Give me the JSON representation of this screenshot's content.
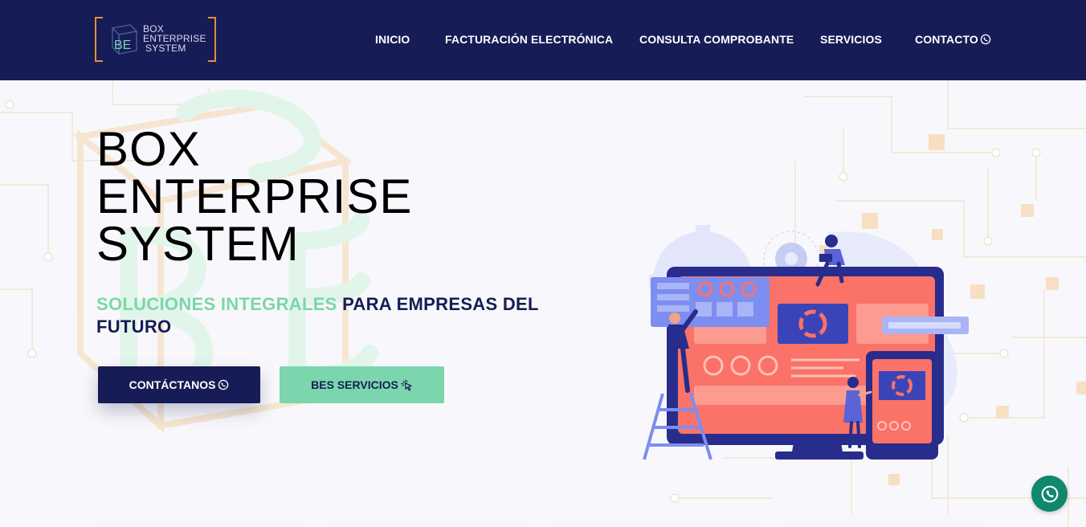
{
  "brand": {
    "logo_lines": [
      "BOX",
      "ENTERPRISE",
      "SYSTEM"
    ],
    "logo_letters": "BE",
    "colors": {
      "navy": "#161c55",
      "green": "#7bd6ad",
      "orange": "#e0913a",
      "coral": "#fa7268"
    }
  },
  "nav": {
    "items": [
      {
        "label": "INICIO"
      },
      {
        "label": "FACTURACIÓN ELECTRÓNICA"
      },
      {
        "label": "CONSULTA COMPROBANTE"
      },
      {
        "label": "SERVICIOS"
      },
      {
        "label": "CONTACTO",
        "icon": "whatsapp-icon"
      }
    ]
  },
  "hero": {
    "title_lines": [
      "BOX",
      "ENTERPRISE",
      "SYSTEM"
    ],
    "subtitle_highlight": "SOLUCIONES INTEGRALES",
    "subtitle_rest": " PARA EMPRESAS DEL FUTURO",
    "primary_button": {
      "label": "CONTÁCTANOS",
      "icon": "whatsapp-icon"
    },
    "secondary_button": {
      "label": "BES SERVICIOS",
      "icon": "cursor-click-icon"
    }
  },
  "floating": {
    "icon": "whatsapp-icon"
  }
}
